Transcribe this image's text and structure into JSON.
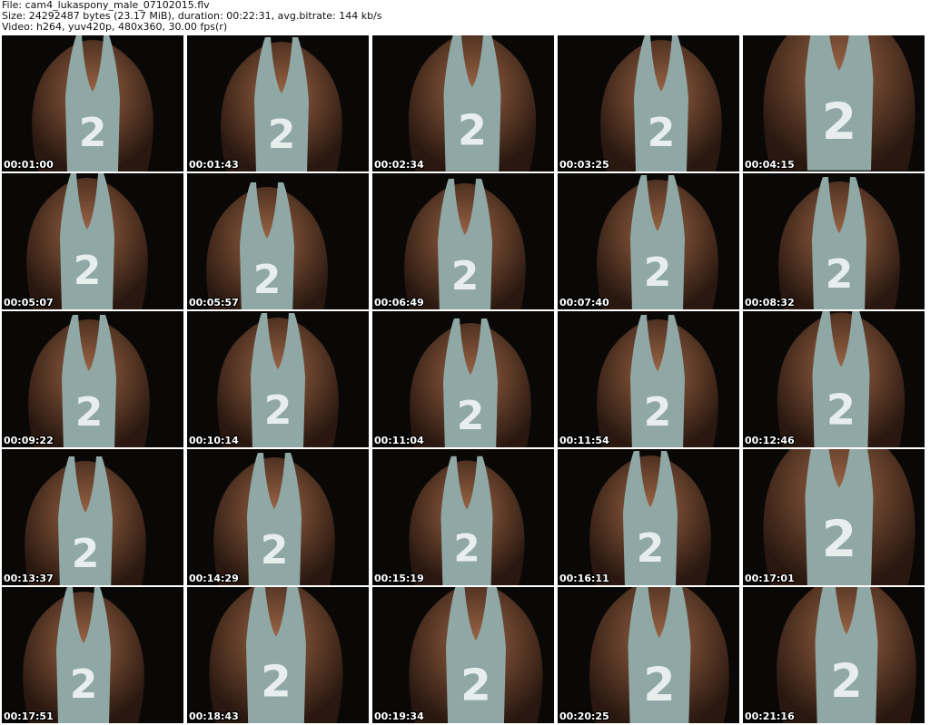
{
  "header": {
    "file_line": "File: cam4_lukaspony_male_07102015.flv",
    "size_line": "Size: 24292487 bytes (23.17 MiB), duration: 00:22:31, avg.bitrate: 144 kb/s",
    "video_line": "Video: h264, yuv420p, 480x360, 30.00 fps(r)"
  },
  "thumbnails": [
    {
      "time": "00:01:00"
    },
    {
      "time": "00:01:43"
    },
    {
      "time": "00:02:34"
    },
    {
      "time": "00:03:25"
    },
    {
      "time": "00:04:15"
    },
    {
      "time": "00:05:07"
    },
    {
      "time": "00:05:57"
    },
    {
      "time": "00:06:49"
    },
    {
      "time": "00:07:40"
    },
    {
      "time": "00:08:32"
    },
    {
      "time": "00:09:22"
    },
    {
      "time": "00:10:14"
    },
    {
      "time": "00:11:04"
    },
    {
      "time": "00:11:54"
    },
    {
      "time": "00:12:46"
    },
    {
      "time": "00:13:37"
    },
    {
      "time": "00:14:29"
    },
    {
      "time": "00:15:19"
    },
    {
      "time": "00:16:11"
    },
    {
      "time": "00:17:01"
    },
    {
      "time": "00:17:51"
    },
    {
      "time": "00:18:43"
    },
    {
      "time": "00:19:34"
    },
    {
      "time": "00:20:25"
    },
    {
      "time": "00:21:16"
    }
  ],
  "colors": {
    "background": "#0a0807",
    "skin": "#7a4a32",
    "shirt": "#8fa8a6",
    "numeral": "#e8eeee"
  }
}
